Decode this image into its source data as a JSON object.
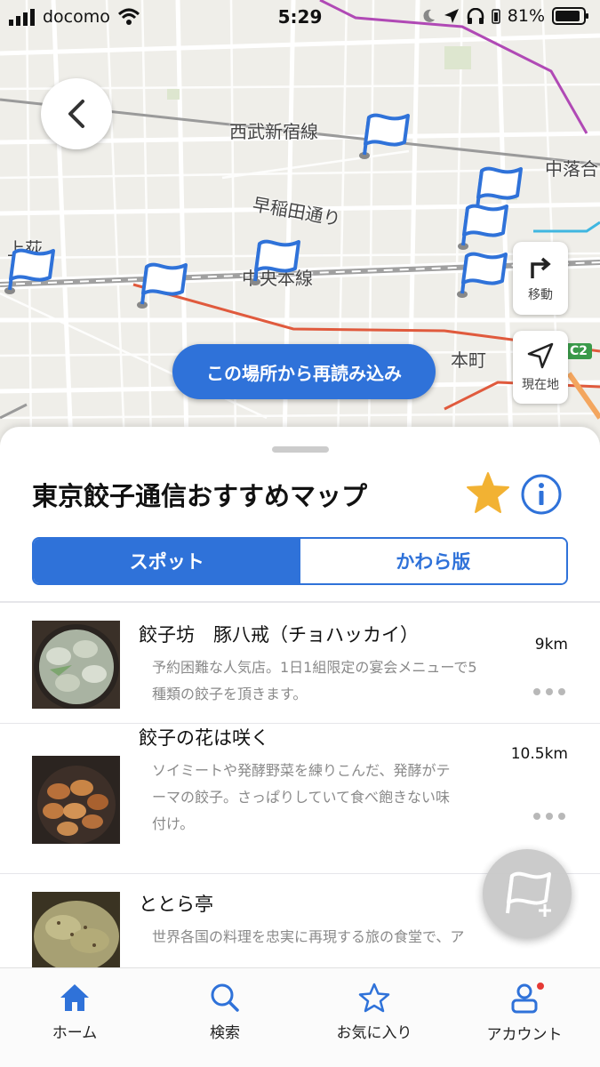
{
  "status_bar": {
    "carrier": "docomo",
    "time": "5:29",
    "battery": "81%"
  },
  "map": {
    "labels": [
      {
        "id": "seibu",
        "text": "西武新宿線"
      },
      {
        "id": "waseda",
        "text": "早稲田通り"
      },
      {
        "id": "chuo",
        "text": "中央本線"
      },
      {
        "id": "nakaochiai",
        "text": "中落合"
      },
      {
        "id": "honcho",
        "text": "本町"
      },
      {
        "id": "kamisagi",
        "text": "上荻"
      },
      {
        "id": "c2",
        "text": "C2"
      }
    ],
    "move_button_label": "移動",
    "location_button_label": "現在地",
    "reload_button_label": "この場所から再読み込み"
  },
  "sheet": {
    "title": "東京餃子通信おすすめマップ",
    "segments": [
      {
        "label": "スポット",
        "active": true
      },
      {
        "label": "かわら版",
        "active": false
      }
    ],
    "items": [
      {
        "title": "餃子坊　豚八戒（チョハッカイ）",
        "distance": "9km",
        "desc_lines": [
          "予約困難な人気店。1日1組限定の宴会メニューで5",
          "種類の餃子を頂きます。"
        ]
      },
      {
        "title": "餃子の花は咲く",
        "distance": "10.5km",
        "desc_lines": [
          "ソイミートや発酵野菜を練りこんだ、発酵がテ",
          "ーマの餃子。さっぱりしていて食べ飽きない味",
          "付け。"
        ]
      },
      {
        "title": "ととら亭",
        "distance": "",
        "desc_lines": [
          "世界各国の料理を忠実に再現する旅の食堂で、ア"
        ]
      }
    ]
  },
  "tabbar": {
    "tabs": [
      {
        "label": "ホーム",
        "icon": "home-icon",
        "active": true
      },
      {
        "label": "検索",
        "icon": "search-icon",
        "active": false
      },
      {
        "label": "お気に入り",
        "icon": "star-outline-icon",
        "active": false
      },
      {
        "label": "アカウント",
        "icon": "account-icon",
        "active": false
      }
    ]
  },
  "colors": {
    "accent": "#2f72d9",
    "star": "#f2b233",
    "badge": "#e53935"
  }
}
